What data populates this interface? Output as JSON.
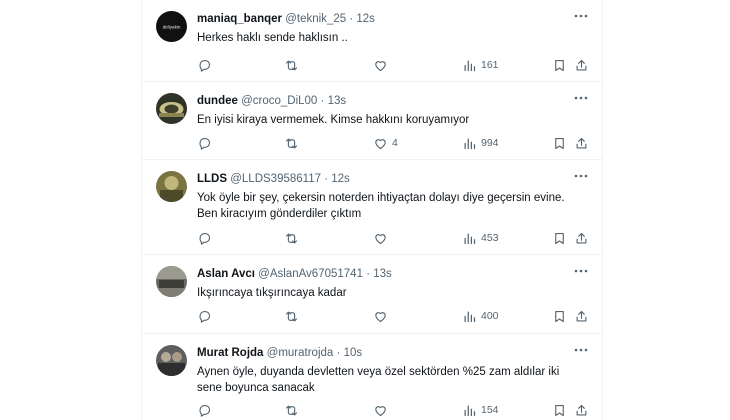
{
  "tweets": [
    {
      "name": "maniaq_banqer",
      "handle": "@teknik_25",
      "time": "12s",
      "text": "Herkes haklı sende haklısın ..",
      "likes": "",
      "views": "161",
      "avatar_text": "deliyakin",
      "avatar_color": "#111111"
    },
    {
      "name": "dundee",
      "handle": "@croco_DiL00",
      "time": "13s",
      "text": "En iyisi kiraya vermemek. Kimse hakkını koruyamıyor",
      "likes": "4",
      "views": "994",
      "avatar_color": "#3a3a2a"
    },
    {
      "name": "LLDS",
      "handle": "@LLDS39586117",
      "time": "12s",
      "text": "Yok öyle bir şey, çekersin noterden ihtiyaçtan dolayı diye geçersin evine.\nBen kiracıyım gönderdiler çıktım",
      "likes": "",
      "views": "453",
      "avatar_color": "#6b6b3a"
    },
    {
      "name": "Aslan Avcı",
      "handle": "@AslanAv67051741",
      "time": "13s",
      "text": "Ikşırıncaya tıkşırıncaya kadar",
      "likes": "",
      "views": "400",
      "avatar_color": "#5a5a55"
    },
    {
      "name": "Murat Rojda",
      "handle": "@muratrojda",
      "time": "10s",
      "text": "Aynen öyle, duyanda devletten veya özel sektörden %25 zam aldılar iki\nsene boyunca sanacak",
      "likes": "",
      "views": "154",
      "avatar_color": "#4a4a4a"
    }
  ],
  "separator": "·",
  "colors": {
    "text": "#0f1419",
    "secondary": "#536471",
    "border": "#eff3f4"
  }
}
